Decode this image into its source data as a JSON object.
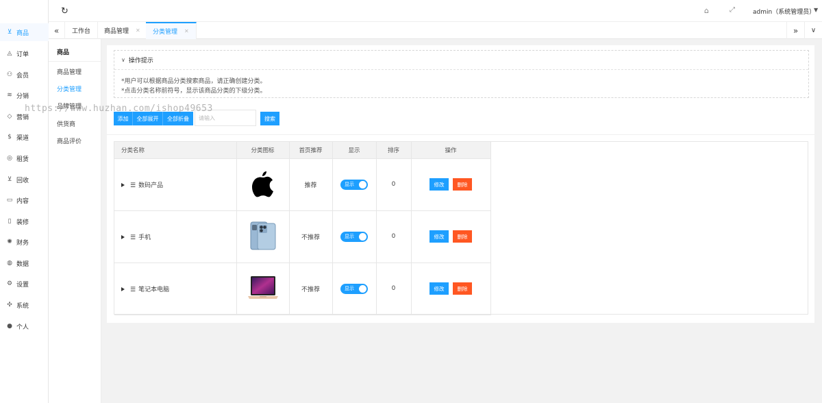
{
  "nav": {
    "items": [
      {
        "label": "商品",
        "icon": "cart-icon",
        "glyph": "⊻",
        "active": true
      },
      {
        "label": "订单",
        "icon": "bell-icon",
        "glyph": "◬",
        "active": false
      },
      {
        "label": "会员",
        "icon": "user-icon",
        "glyph": "⚇",
        "active": false
      },
      {
        "label": "分销",
        "icon": "layers-icon",
        "glyph": "≋",
        "active": false
      },
      {
        "label": "营销",
        "icon": "diamond-icon",
        "glyph": "◇",
        "active": false
      },
      {
        "label": "渠道",
        "icon": "dollar-icon",
        "glyph": "$",
        "active": false
      },
      {
        "label": "租赁",
        "icon": "shield-icon",
        "glyph": "◎",
        "active": false
      },
      {
        "label": "回收",
        "icon": "recycle-cart-icon",
        "glyph": "⊻",
        "active": false
      },
      {
        "label": "内容",
        "icon": "book-icon",
        "glyph": "▭",
        "active": false
      },
      {
        "label": "装修",
        "icon": "tablet-icon",
        "glyph": "▯",
        "active": false
      },
      {
        "label": "财务",
        "icon": "finance-icon",
        "glyph": "✺",
        "active": false
      },
      {
        "label": "数据",
        "icon": "globe-icon",
        "glyph": "◍",
        "active": false
      },
      {
        "label": "设置",
        "icon": "gear-icon",
        "glyph": "⚙",
        "active": false
      },
      {
        "label": "系统",
        "icon": "fan-icon",
        "glyph": "✣",
        "active": false
      },
      {
        "label": "个人",
        "icon": "person-icon",
        "glyph": "●",
        "active": false
      }
    ]
  },
  "subnav": {
    "title": "商品",
    "items": [
      {
        "label": "商品管理",
        "active": false
      },
      {
        "label": "分类管理",
        "active": true
      },
      {
        "label": "品牌管理",
        "active": false
      },
      {
        "label": "供货商",
        "active": false
      },
      {
        "label": "商品评价",
        "active": false
      }
    ]
  },
  "topbar": {
    "refresh_icon": "refresh-icon",
    "user": "admin（系统管理员）"
  },
  "tabs": [
    {
      "label": "工作台",
      "closable": false,
      "active": false
    },
    {
      "label": "商品管理",
      "closable": true,
      "active": false
    },
    {
      "label": "分类管理",
      "closable": true,
      "active": true
    }
  ],
  "tips": {
    "title": "操作提示",
    "lines": [
      "*用户可以根据商品分类搜索商品，请正确创建分类。",
      "*点击分类名称前符号，显示该商品分类的下级分类。"
    ]
  },
  "toolbar": {
    "add": "添加",
    "expand_all": "全部展开",
    "collapse_all": "全部折叠",
    "search_placeholder": "请输入",
    "search": "搜索"
  },
  "table": {
    "columns": [
      "分类名称",
      "分类图标",
      "首页推荐",
      "显示",
      "排序",
      "操作"
    ],
    "rows": [
      {
        "name": "数码产品",
        "icon": "apple-logo-icon",
        "recommend": "推荐",
        "show": "显示",
        "sort": "0",
        "edit": "修改",
        "delete": "删除"
      },
      {
        "name": "手机",
        "icon": "phone-image-icon",
        "recommend": "不推荐",
        "show": "显示",
        "sort": "0",
        "edit": "修改",
        "delete": "删除"
      },
      {
        "name": "笔记本电脑",
        "icon": "laptop-image-icon",
        "recommend": "不推荐",
        "show": "显示",
        "sort": "0",
        "edit": "修改",
        "delete": "删除"
      }
    ]
  },
  "watermark": "https://www.huzhan.com/ishop49653"
}
